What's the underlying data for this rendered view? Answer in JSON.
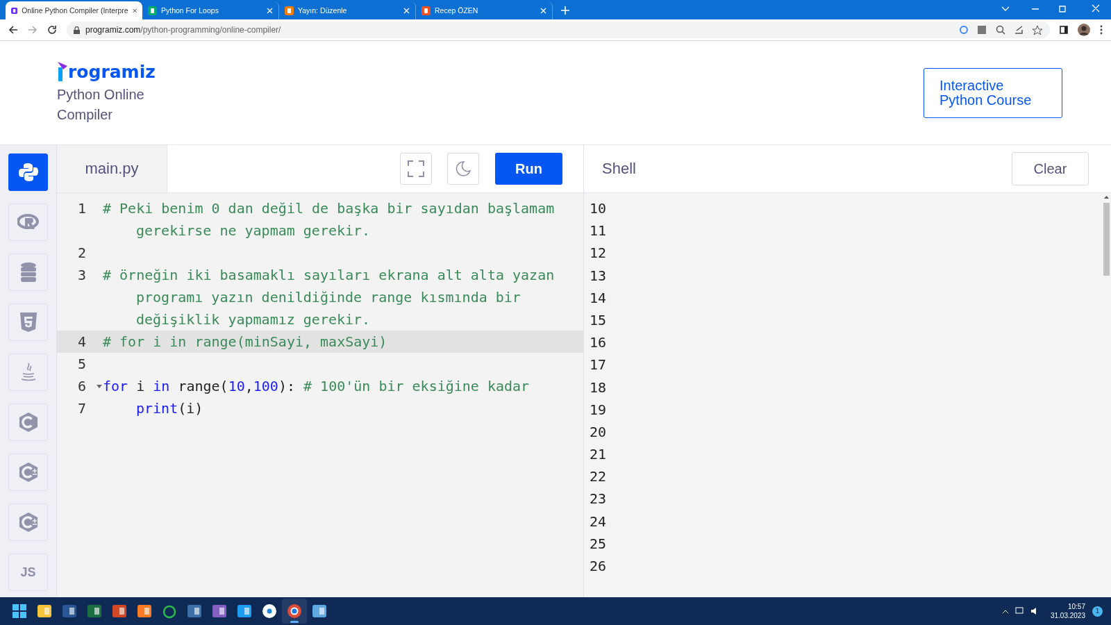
{
  "browser": {
    "tabs": [
      {
        "kind": "programiz",
        "title": "Online Python Compiler (Interpre",
        "selected": true
      },
      {
        "kind": "w3schools",
        "title": "Python For Loops",
        "selected": false
      },
      {
        "kind": "blogger",
        "title": "Yayın: Düzenle",
        "selected": false
      },
      {
        "kind": "blogger-profile",
        "title": "Recep ÖZEN",
        "selected": false
      }
    ],
    "address": {
      "host": "programiz.com",
      "path": "/python-programming/online-compiler/"
    }
  },
  "header": {
    "logo": "rogramiz",
    "subtitle": "Python Online Compiler",
    "course_button": "Interactive Python Course"
  },
  "sidebar": [
    {
      "kind": "python",
      "selected": true
    },
    {
      "kind": "r",
      "selected": false
    },
    {
      "kind": "sql",
      "selected": false
    },
    {
      "kind": "html",
      "selected": false
    },
    {
      "kind": "java",
      "selected": false
    },
    {
      "kind": "c",
      "selected": false
    },
    {
      "kind": "cpp",
      "selected": false
    },
    {
      "kind": "csharp",
      "selected": false
    },
    {
      "kind": "js",
      "label": "JS",
      "selected": false
    }
  ],
  "editor": {
    "file_tab": "main.py",
    "run_button": "Run",
    "lines": [
      {
        "number": "1",
        "active": false,
        "fold": false,
        "indent": false,
        "rows": [
          [
            {
              "kind": "comment",
              "s": "# Peki benim 0 dan değil de başka bir sayıdan başlamam"
            }
          ],
          [
            {
              "kind": "comment",
              "s": "gerekirse ne yapmam gerekir."
            }
          ]
        ]
      },
      {
        "number": "2",
        "active": false,
        "fold": false,
        "rows": [
          []
        ]
      },
      {
        "number": "3",
        "active": false,
        "fold": false,
        "indent": false,
        "rows": [
          [
            {
              "kind": "comment",
              "s": "# örneğin iki basamaklı sayıları ekrana alt alta yazan"
            }
          ],
          [
            {
              "kind": "comment",
              "s": "programı yazın denildiğinde range kısmında bir"
            }
          ],
          [
            {
              "kind": "comment",
              "s": "değişiklik yapmamız gerekir."
            }
          ]
        ]
      },
      {
        "number": "4",
        "active": true,
        "fold": false,
        "indent": false,
        "rows": [
          [
            {
              "kind": "comment",
              "s": "# for i in range(minSayi, maxSayi)"
            }
          ]
        ]
      },
      {
        "number": "5",
        "active": false,
        "fold": false,
        "rows": [
          []
        ]
      },
      {
        "number": "6",
        "active": false,
        "fold": true,
        "indent": false,
        "rows": [
          [
            {
              "kind": "keyword",
              "s": "for"
            },
            {
              "kind": "plain",
              "s": " i "
            },
            {
              "kind": "keyword",
              "s": "in"
            },
            {
              "kind": "plain",
              "s": " range("
            },
            {
              "kind": "number",
              "s": "10"
            },
            {
              "kind": "plain",
              "s": ","
            },
            {
              "kind": "number",
              "s": "100"
            },
            {
              "kind": "plain",
              "s": "): "
            },
            {
              "kind": "comment",
              "s": "# 100'ün bir eksiğine kadar"
            }
          ]
        ]
      },
      {
        "number": "7",
        "active": false,
        "fold": false,
        "indent": true,
        "rows": [
          [
            {
              "kind": "keyword",
              "s": "print"
            },
            {
              "kind": "plain",
              "s": "(i)"
            }
          ]
        ]
      }
    ]
  },
  "shell": {
    "title": "Shell",
    "clear_button": "Clear",
    "output": [
      "10",
      "11",
      "12",
      "13",
      "14",
      "15",
      "16",
      "17",
      "18",
      "19",
      "20",
      "21",
      "22",
      "23",
      "24",
      "25",
      "26"
    ]
  },
  "taskbar": {
    "apps": [
      {
        "kind": "windows",
        "selected": false
      },
      {
        "kind": "explorer",
        "selected": false
      },
      {
        "kind": "word",
        "selected": false
      },
      {
        "kind": "excel",
        "selected": false
      },
      {
        "kind": "powerpoint",
        "selected": false
      },
      {
        "kind": "xampp",
        "selected": false
      },
      {
        "kind": "navicat",
        "selected": false
      },
      {
        "kind": "monitor",
        "selected": false
      },
      {
        "kind": "visual-studio",
        "selected": false
      },
      {
        "kind": "vscode",
        "selected": false
      },
      {
        "kind": "app",
        "selected": false
      },
      {
        "kind": "chrome",
        "selected": true
      },
      {
        "kind": "notepad",
        "selected": false
      }
    ],
    "time": "10:57",
    "date": "31.03.2023",
    "notifications": "1"
  }
}
